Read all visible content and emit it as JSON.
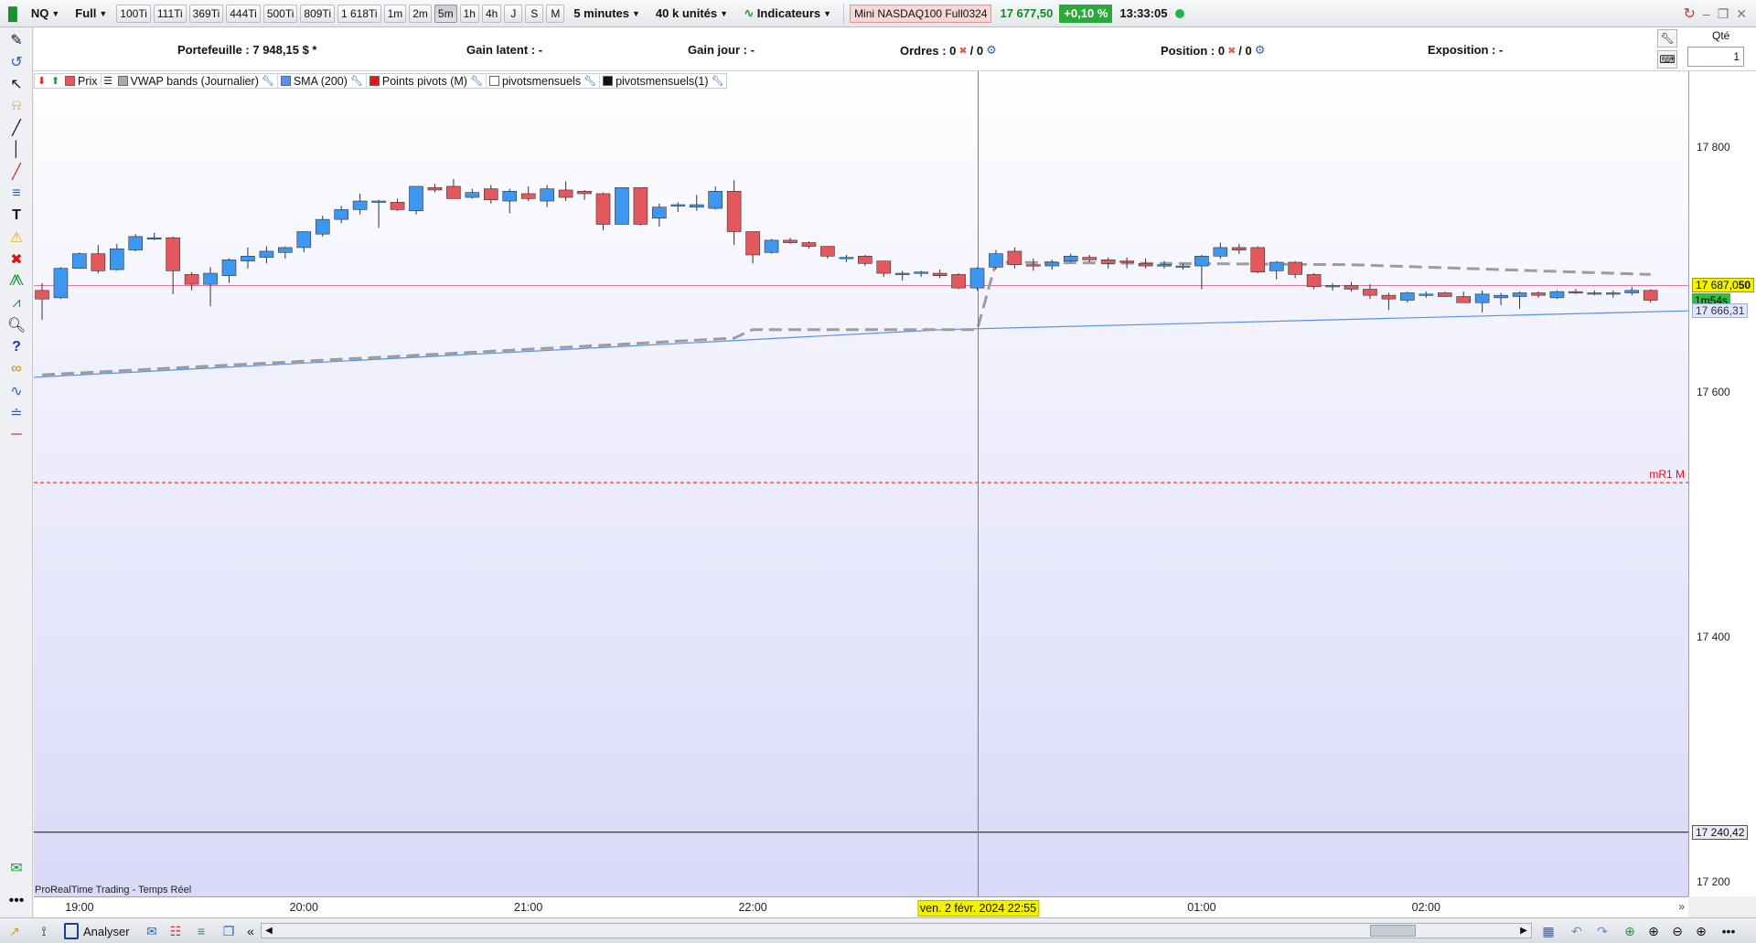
{
  "toolbar": {
    "symbol": "NQ",
    "mode": "Full",
    "tick_buttons": [
      "100Ti",
      "111Ti",
      "369Ti",
      "444Ti",
      "500Ti",
      "809Ti",
      "1 618Ti"
    ],
    "period_buttons": [
      "1m",
      "2m",
      "5m",
      "1h",
      "4h",
      "J",
      "S",
      "M"
    ],
    "active_period": "5m",
    "timeframe": "5 minutes",
    "units": "40 k unités",
    "indicators_label": "Indicateurs",
    "instrument": "Mini NASDAQ100 Full0324",
    "last_price": "17 677,50",
    "change_pct": "+0,10 %",
    "clock": "13:33:05"
  },
  "portfolio_bar": {
    "portefeuille": "Portefeuille : 7 948,15 $ *",
    "gain_latent": "Gain latent : -",
    "gain_jour": "Gain jour : -",
    "ordres": "Ordres : 0",
    "ordres_2": "/ 0",
    "position": "Position : 0",
    "position_2": "/ 0",
    "exposition": "Exposition : -"
  },
  "order_panel": {
    "qty_label": "Qté",
    "qty_value": "1"
  },
  "legend": [
    {
      "label": "Prix",
      "color": "#e85a5a"
    },
    {
      "label": "VWAP bands (Journalier)",
      "color": "#aaaaaa"
    },
    {
      "label": "SMA (200)",
      "color": "#5b8fe8"
    },
    {
      "label": "Points pivots (M)",
      "color": "#ee1111"
    },
    {
      "label": "pivotsmensuels",
      "color": "#ffffff"
    },
    {
      "label": "pivotsmensuels(1)",
      "color": "#111111"
    }
  ],
  "price_axis": {
    "ticks": [
      "17 800",
      "17 600",
      "17 400",
      "17 200"
    ],
    "last_price_tag": "17 687,0",
    "last_price_tag_suffix": "50",
    "countdown": "1m54s",
    "sma_tag": "17 666,31",
    "line_tag": "17 240,42"
  },
  "pivot_label": "mR1 M",
  "time_axis": {
    "ticks": [
      "19:00",
      "20:00",
      "21:00",
      "22:00",
      "01:00",
      "02:00"
    ],
    "cursor_label": "ven. 2 févr. 2024 22:55"
  },
  "footer_label": "ProRealTime Trading - Temps Réel",
  "bottom": {
    "analyser_label": "Analyser"
  },
  "colors": {
    "bull": "#3d97f0",
    "bear": "#e3585d",
    "sma": "#5b8fe8",
    "vwap": "#9c9c9c",
    "pivot": "#ee1111",
    "cursor": "#e040c0"
  },
  "chart_data": {
    "type": "candlestick",
    "interval": "5 minutes",
    "ylim": [
      17188,
      17862
    ],
    "candles": [
      {
        "o": 17683,
        "h": 17689,
        "l": 17659,
        "c": 17676
      },
      {
        "o": 17677,
        "h": 17702,
        "l": 17676,
        "c": 17701
      },
      {
        "o": 17701,
        "h": 17714,
        "l": 17701,
        "c": 17713
      },
      {
        "o": 17713,
        "h": 17720,
        "l": 17697,
        "c": 17699
      },
      {
        "o": 17700,
        "h": 17721,
        "l": 17699,
        "c": 17717
      },
      {
        "o": 17716,
        "h": 17729,
        "l": 17715,
        "c": 17727
      },
      {
        "o": 17725,
        "h": 17730,
        "l": 17724,
        "c": 17726
      },
      {
        "o": 17726,
        "h": 17727,
        "l": 17680,
        "c": 17699
      },
      {
        "o": 17696,
        "h": 17698,
        "l": 17683,
        "c": 17688
      },
      {
        "o": 17688,
        "h": 17702,
        "l": 17670,
        "c": 17697
      },
      {
        "o": 17695,
        "h": 17709,
        "l": 17689,
        "c": 17708
      },
      {
        "o": 17707,
        "h": 17718,
        "l": 17701,
        "c": 17711
      },
      {
        "o": 17710,
        "h": 17719,
        "l": 17705,
        "c": 17715
      },
      {
        "o": 17714,
        "h": 17719,
        "l": 17709,
        "c": 17718
      },
      {
        "o": 17718,
        "h": 17731,
        "l": 17714,
        "c": 17731
      },
      {
        "o": 17729,
        "h": 17744,
        "l": 17727,
        "c": 17741
      },
      {
        "o": 17741,
        "h": 17752,
        "l": 17738,
        "c": 17749
      },
      {
        "o": 17749,
        "h": 17762,
        "l": 17745,
        "c": 17756
      },
      {
        "o": 17756,
        "h": 17757,
        "l": 17734,
        "c": 17756
      },
      {
        "o": 17755,
        "h": 17758,
        "l": 17748,
        "c": 17749
      },
      {
        "o": 17748,
        "h": 17768,
        "l": 17745,
        "c": 17768
      },
      {
        "o": 17767,
        "h": 17770,
        "l": 17763,
        "c": 17765
      },
      {
        "o": 17768,
        "h": 17774,
        "l": 17758,
        "c": 17758
      },
      {
        "o": 17759,
        "h": 17766,
        "l": 17758,
        "c": 17763
      },
      {
        "o": 17766,
        "h": 17769,
        "l": 17754,
        "c": 17757
      },
      {
        "o": 17756,
        "h": 17766,
        "l": 17746,
        "c": 17764
      },
      {
        "o": 17762,
        "h": 17768,
        "l": 17756,
        "c": 17758
      },
      {
        "o": 17756,
        "h": 17769,
        "l": 17751,
        "c": 17766
      },
      {
        "o": 17765,
        "h": 17772,
        "l": 17756,
        "c": 17759
      },
      {
        "o": 17764,
        "h": 17765,
        "l": 17757,
        "c": 17762
      },
      {
        "o": 17762,
        "h": 17763,
        "l": 17732,
        "c": 17737
      },
      {
        "o": 17737,
        "h": 17767,
        "l": 17737,
        "c": 17767
      },
      {
        "o": 17767,
        "h": 17767,
        "l": 17736,
        "c": 17737
      },
      {
        "o": 17742,
        "h": 17754,
        "l": 17735,
        "c": 17751
      },
      {
        "o": 17752,
        "h": 17755,
        "l": 17747,
        "c": 17753
      },
      {
        "o": 17751,
        "h": 17761,
        "l": 17748,
        "c": 17753
      },
      {
        "o": 17750,
        "h": 17768,
        "l": 17749,
        "c": 17764
      },
      {
        "o": 17764,
        "h": 17773,
        "l": 17720,
        "c": 17731
      },
      {
        "o": 17731,
        "h": 17731,
        "l": 17705,
        "c": 17712
      },
      {
        "o": 17714,
        "h": 17725,
        "l": 17713,
        "c": 17724
      },
      {
        "o": 17724,
        "h": 17726,
        "l": 17721,
        "c": 17722
      },
      {
        "o": 17722,
        "h": 17723,
        "l": 17717,
        "c": 17719
      },
      {
        "o": 17719,
        "h": 17718,
        "l": 17709,
        "c": 17711
      },
      {
        "o": 17709,
        "h": 17712,
        "l": 17706,
        "c": 17710
      },
      {
        "o": 17711,
        "h": 17712,
        "l": 17703,
        "c": 17705
      },
      {
        "o": 17707,
        "h": 17707,
        "l": 17694,
        "c": 17697
      },
      {
        "o": 17697,
        "h": 17699,
        "l": 17691,
        "c": 17697
      },
      {
        "o": 17697,
        "h": 17699,
        "l": 17694,
        "c": 17698
      },
      {
        "o": 17697,
        "h": 17700,
        "l": 17693,
        "c": 17695
      },
      {
        "o": 17696,
        "h": 17697,
        "l": 17684,
        "c": 17685
      },
      {
        "o": 17685,
        "h": 17702,
        "l": 17683,
        "c": 17701
      },
      {
        "o": 17702,
        "h": 17716,
        "l": 17700,
        "c": 17713
      },
      {
        "o": 17715,
        "h": 17718,
        "l": 17701,
        "c": 17704
      },
      {
        "o": 17704,
        "h": 17709,
        "l": 17699,
        "c": 17703
      },
      {
        "o": 17703,
        "h": 17708,
        "l": 17700,
        "c": 17706
      },
      {
        "o": 17707,
        "h": 17713,
        "l": 17706,
        "c": 17711
      },
      {
        "o": 17710,
        "h": 17712,
        "l": 17706,
        "c": 17708
      },
      {
        "o": 17708,
        "h": 17710,
        "l": 17701,
        "c": 17705
      },
      {
        "o": 17707,
        "h": 17710,
        "l": 17701,
        "c": 17706
      },
      {
        "o": 17705,
        "h": 17709,
        "l": 17701,
        "c": 17703
      },
      {
        "o": 17703,
        "h": 17707,
        "l": 17701,
        "c": 17704
      },
      {
        "o": 17703,
        "h": 17705,
        "l": 17700,
        "c": 17703
      },
      {
        "o": 17703,
        "h": 17712,
        "l": 17684,
        "c": 17711
      },
      {
        "o": 17711,
        "h": 17722,
        "l": 17709,
        "c": 17718
      },
      {
        "o": 17718,
        "h": 17721,
        "l": 17713,
        "c": 17716
      },
      {
        "o": 17718,
        "h": 17719,
        "l": 17697,
        "c": 17698
      },
      {
        "o": 17699,
        "h": 17707,
        "l": 17692,
        "c": 17706
      },
      {
        "o": 17706,
        "h": 17707,
        "l": 17693,
        "c": 17696
      },
      {
        "o": 17696,
        "h": 17697,
        "l": 17684,
        "c": 17686
      },
      {
        "o": 17686,
        "h": 17689,
        "l": 17683,
        "c": 17687
      },
      {
        "o": 17687,
        "h": 17690,
        "l": 17682,
        "c": 17684
      },
      {
        "o": 17684,
        "h": 17688,
        "l": 17676,
        "c": 17679
      },
      {
        "o": 17679,
        "h": 17681,
        "l": 17667,
        "c": 17676
      },
      {
        "o": 17675,
        "h": 17682,
        "l": 17673,
        "c": 17681
      },
      {
        "o": 17680,
        "h": 17682,
        "l": 17677,
        "c": 17680
      },
      {
        "o": 17681,
        "h": 17682,
        "l": 17678,
        "c": 17678
      },
      {
        "o": 17678,
        "h": 17682,
        "l": 17673,
        "c": 17673
      },
      {
        "o": 17673,
        "h": 17683,
        "l": 17665,
        "c": 17680
      },
      {
        "o": 17677,
        "h": 17681,
        "l": 17671,
        "c": 17679
      },
      {
        "o": 17678,
        "h": 17682,
        "l": 17668,
        "c": 17681
      },
      {
        "o": 17681,
        "h": 17682,
        "l": 17677,
        "c": 17679
      },
      {
        "o": 17677,
        "h": 17683,
        "l": 17676,
        "c": 17682
      },
      {
        "o": 17682,
        "h": 17684,
        "l": 17680,
        "c": 17681
      },
      {
        "o": 17680,
        "h": 17683,
        "l": 17679,
        "c": 17681
      },
      {
        "o": 17680,
        "h": 17683,
        "l": 17677,
        "c": 17681
      },
      {
        "o": 17681,
        "h": 17686,
        "l": 17679,
        "c": 17683
      },
      {
        "o": 17683,
        "h": 17684,
        "l": 17673,
        "c": 17675
      }
    ],
    "sma_200": {
      "start": 17612,
      "mid": 17651,
      "end": 17666.31
    },
    "vwap_band": [
      {
        "i": 0,
        "v": 17614
      },
      {
        "i": 20,
        "v": 17630
      },
      {
        "i": 37,
        "v": 17644
      },
      {
        "i": 38,
        "v": 17651
      },
      {
        "i": 50,
        "v": 17651
      },
      {
        "i": 51,
        "v": 17706
      },
      {
        "i": 70,
        "v": 17704
      },
      {
        "i": 86,
        "v": 17696
      }
    ],
    "pivot_mR1M": 17526,
    "horizontal_line": 17240.42,
    "last_price_line": 17687,
    "x_ticks": [
      "19:00",
      "20:00",
      "21:00",
      "22:00",
      "01:00",
      "02:00"
    ],
    "cursor": "ven. 2 févr. 2024 22:55"
  }
}
